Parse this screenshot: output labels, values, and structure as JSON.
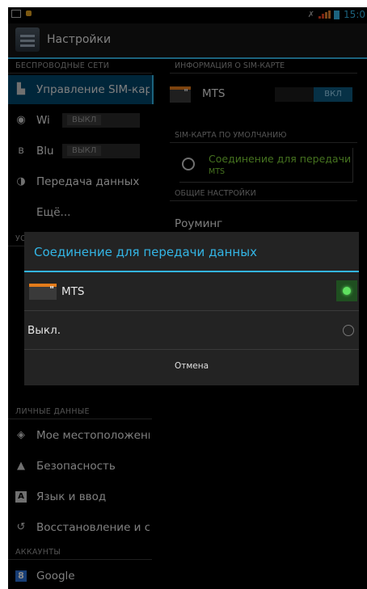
{
  "status_bar": {
    "time": "15:0",
    "icons": [
      "image-icon",
      "bug-icon",
      "silent-icon",
      "signal-icon",
      "battery-icon"
    ]
  },
  "action_bar": {
    "title": "Настройки"
  },
  "left": {
    "wireless_header": "БЕСПРОВОДНЫЕ СЕТИ",
    "items": [
      {
        "label": "Управление SIM-кар",
        "icon": "sim-icon"
      },
      {
        "label": "Wi",
        "icon": "wifi-icon",
        "toggle": "ВЫКЛ"
      },
      {
        "label": "Blu",
        "icon": "bluetooth-icon",
        "toggle": "ВЫКЛ"
      },
      {
        "label": "Передача данных",
        "icon": "data-usage-icon"
      },
      {
        "label": "Ещё...",
        "icon": ""
      }
    ],
    "device_header_partial": "УС",
    "personal_header": "ЛИЧНЫЕ ДАННЫЕ",
    "personal_items": [
      {
        "label": "Мое местоположени",
        "icon": "location-icon"
      },
      {
        "label": "Безопасность",
        "icon": "lock-icon"
      },
      {
        "label": "Язык и ввод",
        "icon": "language-icon"
      },
      {
        "label": "Восстановление и с",
        "icon": "backup-icon"
      }
    ],
    "accounts_header": "АККАУНТЫ",
    "accounts": [
      {
        "label": "Google",
        "icon": "google-icon"
      }
    ]
  },
  "right": {
    "sim_info_header": "ИНФОРМАЦИЯ О SIM-КАРТЕ",
    "sim_name": "MTS",
    "sim_toggle": "ВКЛ",
    "default_sim_header": "SIM-КАРТА ПО УМОЛЧАНИЮ",
    "data_conn_title": "Соединение для передачи",
    "data_conn_value": "MTS",
    "general_header": "ОБЩИЕ НАСТРОЙКИ",
    "roaming": "Роуминг"
  },
  "dialog": {
    "title": "Соединение для передачи данных",
    "options": [
      {
        "label": "MTS",
        "selected": true
      },
      {
        "label": "Выкл.",
        "selected": false
      }
    ],
    "cancel": "Отмена"
  },
  "colors": {
    "accent": "#33b5e5",
    "selected_item_bg": "#00466b",
    "green_text": "#7fd03a",
    "sim_orange": "#e37b1a"
  }
}
